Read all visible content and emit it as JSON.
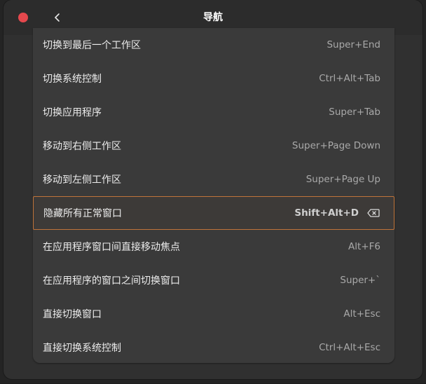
{
  "window": {
    "title": "导航"
  },
  "shortcuts": [
    {
      "label": "切换到最后一个工作区",
      "accel": "Super+End"
    },
    {
      "label": "切换系统控制",
      "accel": "Ctrl+Alt+Tab"
    },
    {
      "label": "切换应用程序",
      "accel": "Super+Tab"
    },
    {
      "label": "移动到右侧工作区",
      "accel": "Super+Page Down"
    },
    {
      "label": "移动到左侧工作区",
      "accel": "Super+Page Up"
    },
    {
      "label": "隐藏所有正常窗口",
      "accel": "Shift+Alt+D",
      "selected": true
    },
    {
      "label": "在应用程序窗口间直接移动焦点",
      "accel": "Alt+F6"
    },
    {
      "label": "在应用程序的窗口之间切换窗口",
      "accel": "Super+`"
    },
    {
      "label": "直接切换窗口",
      "accel": "Alt+Esc"
    },
    {
      "label": "直接切换系统控制",
      "accel": "Ctrl+Alt+Esc"
    }
  ],
  "colors": {
    "close": "#e5484d",
    "selection_border": "#c0743a"
  },
  "icons": {
    "close": "close-icon",
    "back": "chevron-left-icon",
    "clear": "backspace-clear-icon"
  }
}
